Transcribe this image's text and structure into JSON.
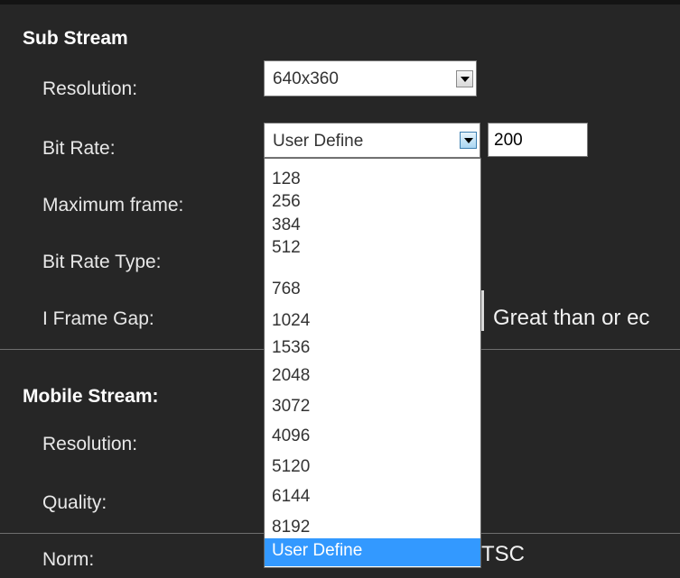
{
  "sub_stream": {
    "title": "Sub Stream",
    "resolution_label": "Resolution:",
    "resolution_value": "640x360",
    "bit_rate_label": "Bit Rate:",
    "bit_rate_value": "User Define",
    "bit_rate_custom": "200",
    "max_frame_label": "Maximum frame:",
    "bit_rate_type_label": "Bit Rate Type:",
    "i_frame_gap_label": "I Frame Gap:",
    "i_frame_gap_hint": "Great than or ec"
  },
  "mobile_stream": {
    "title": "Mobile Stream:",
    "resolution_label": "Resolution:",
    "quality_label": "Quality:"
  },
  "norm": {
    "label": "Norm:",
    "value_partial": "TSC"
  },
  "bit_rate_dropdown": {
    "options": [
      "128",
      "256",
      "384",
      "512",
      "768",
      "1024",
      "1536",
      "2048",
      "3072",
      "4096",
      "5120",
      "6144",
      "8192",
      "User Define"
    ],
    "selected": "User Define"
  },
  "icons": {
    "dropdown_arrow": "chevron-down-icon"
  }
}
